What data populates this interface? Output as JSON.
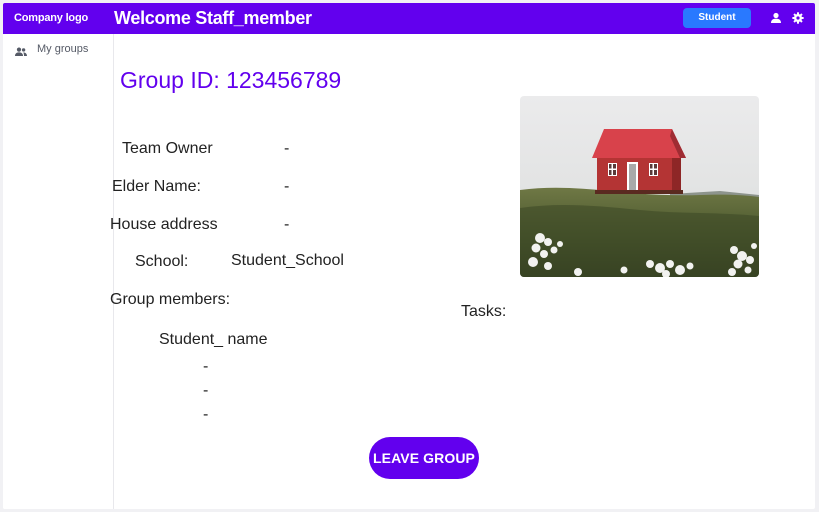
{
  "header": {
    "logo_text": "Company logo",
    "welcome": "Welcome Staff_member",
    "role_button": "Student",
    "icons": [
      "person-icon",
      "gear-icon"
    ]
  },
  "sidebar": {
    "items": [
      {
        "label": "My groups",
        "icon": "group-icon"
      }
    ]
  },
  "group": {
    "id_text": "Group ID: 123456789",
    "team_owner": {
      "label": "Team Owner",
      "value": "-"
    },
    "elder_name": {
      "label": "Elder Name:",
      "value": "-"
    },
    "house_address": {
      "label": "House address",
      "value": "-"
    },
    "school": {
      "label": "School:",
      "value": "Student_School"
    },
    "members_label": "Group members:",
    "member_header": "Student_ name",
    "members": [
      "-",
      "-",
      "-"
    ],
    "tasks_label": "Tasks:",
    "leave_button": "LEAVE GROUP"
  },
  "colors": {
    "primary": "#6200ee",
    "accent": "#2979ff",
    "background": "#ffffff"
  }
}
